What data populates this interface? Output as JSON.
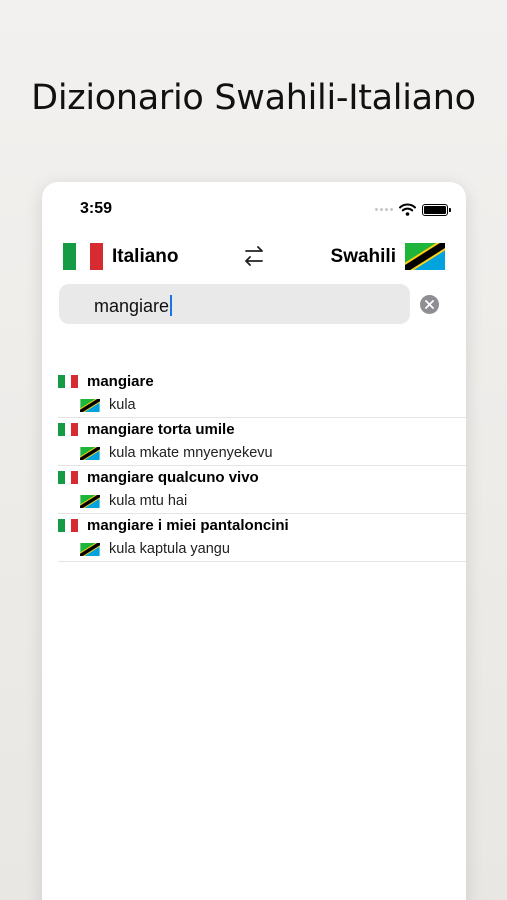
{
  "headline": "Dizionario Swahili-Italiano",
  "status": {
    "time": "3:59"
  },
  "langbar": {
    "source": "Italiano",
    "target": "Swahili"
  },
  "search": {
    "value": "mangiare"
  },
  "results": [
    {
      "source": "mangiare",
      "translation": "kula"
    },
    {
      "source": "mangiare torta umile",
      "translation": "kula mkate mnyenyekevu"
    },
    {
      "source": "mangiare qualcuno vivo",
      "translation": "kula mtu hai"
    },
    {
      "source": "mangiare i miei pantaloncini",
      "translation": "kula kaptula yangu"
    }
  ],
  "colors": {
    "italy_green": "#169b45",
    "italy_red": "#d72b32",
    "tanzania_green": "#1eb53a",
    "tanzania_yellow": "#fcd116",
    "tanzania_blue": "#00a3dd",
    "search_bg": "#e9e9ea",
    "cursor": "#1a73e8"
  }
}
